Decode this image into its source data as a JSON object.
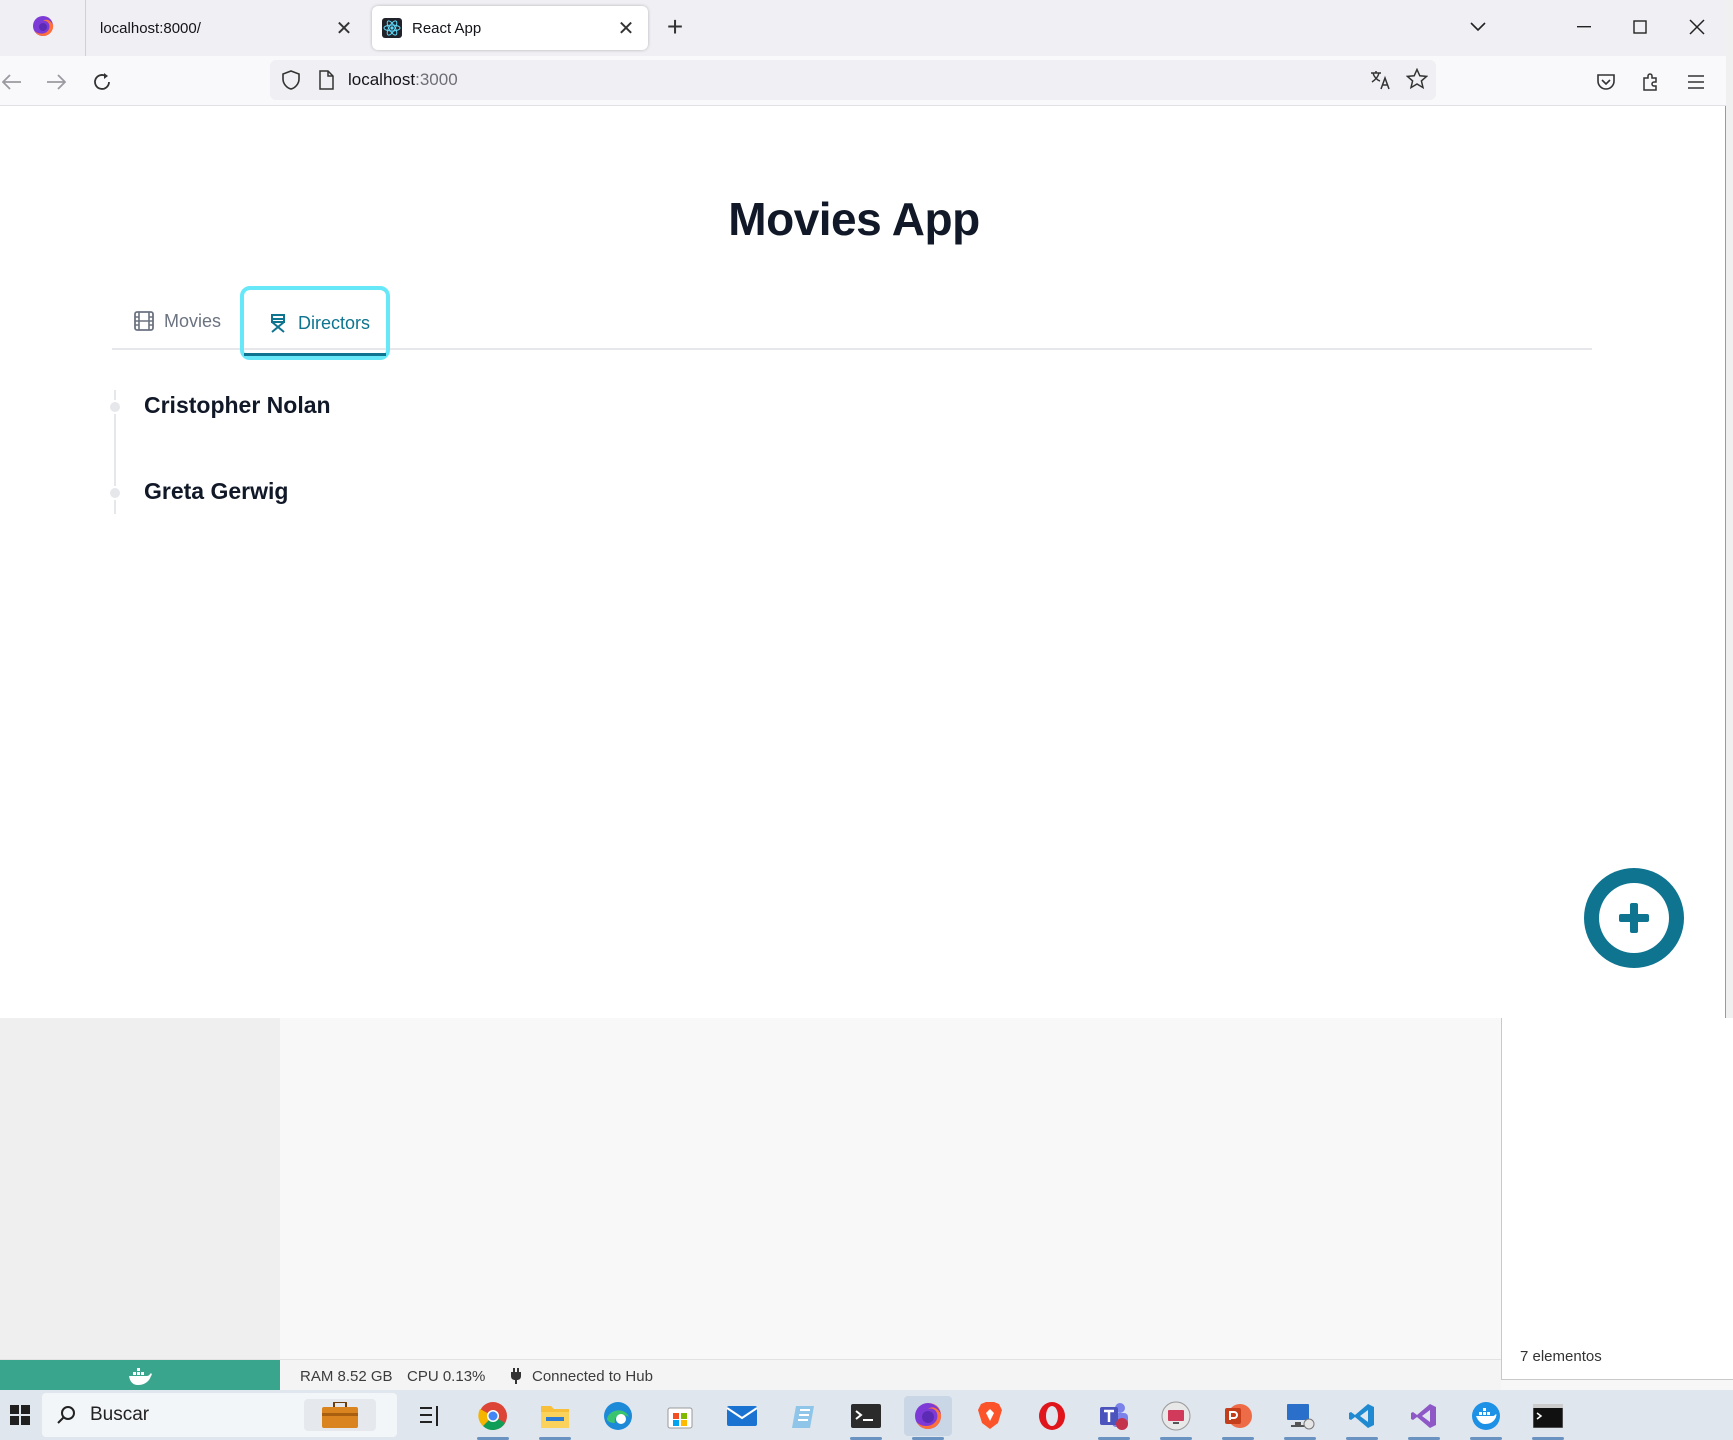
{
  "browser": {
    "tabs": [
      {
        "label": "localhost:8000/",
        "close": "✕"
      },
      {
        "label": "React App",
        "close": "✕"
      }
    ],
    "new_tab": "+",
    "url_host": "localhost",
    "url_port": ":3000"
  },
  "app": {
    "title": "Movies App",
    "tabs": [
      {
        "label": "Movies",
        "icon": "film-icon",
        "active": false
      },
      {
        "label": "Directors",
        "icon": "director-chair-icon",
        "active": true
      }
    ],
    "directors": [
      "Cristopher Nolan",
      "Greta Gerwig"
    ],
    "fab_icon": "plus-circle-icon",
    "accent_color": "#0e7490",
    "focus_ring_color": "#67e8f9"
  },
  "docker": {
    "ram": "RAM 8.52 GB",
    "cpu": "CPU 0.13%",
    "hub": "Connected to Hub",
    "status_color": "#3aa58d"
  },
  "explorer": {
    "count": "7 elementos"
  },
  "taskbar": {
    "search_placeholder": "Buscar"
  }
}
